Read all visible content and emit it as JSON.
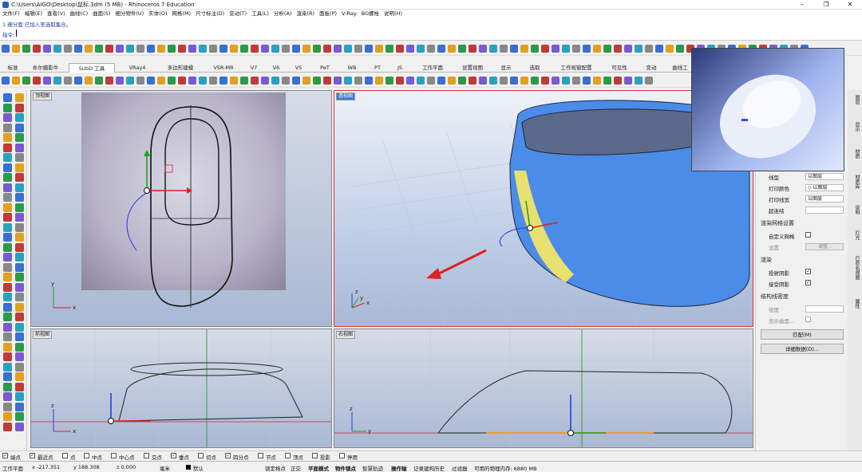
{
  "titlebar": {
    "title": "C:\\Users\\AIGO\\Desktop\\鼠标.3dm (5 MB) - Rhinoceros 7 Education"
  },
  "menu": [
    "文件(F)",
    "编辑(E)",
    "查看(V)",
    "曲线(C)",
    "曲面(S)",
    "细分物件(U)",
    "实体(O)",
    "网格(M)",
    "尺寸标注(D)",
    "变动(T)",
    "工具(L)",
    "分析(A)",
    "渲染(R)",
    "面板(P)",
    "V-Ray",
    "BG螺栓",
    "说明(H)"
  ],
  "command": {
    "history": "1 细分面 已加入至选取集合。",
    "prompt": "指令:"
  },
  "tabs": [
    "标准",
    "牟尔摄影牛",
    "SubD 工具",
    "VRay4",
    "多边形建模",
    "VSR-MR",
    "V7",
    "V6",
    "V5",
    "PeT",
    "WB",
    "PT",
    "JS",
    "工作平面",
    "设置视图",
    "显示",
    "选取",
    "工作视窗配置",
    "可见性",
    "变动",
    "曲线工"
  ],
  "viewports": {
    "top": "顶视图",
    "perspective": "透视图",
    "front": "前视图",
    "right": "右视图"
  },
  "axis": {
    "x": "x",
    "y": "y",
    "z": "z"
  },
  "rightpanel": {
    "linetype_label": "线型",
    "linetype_val": "以图层",
    "printcolor_label": "打印颜色",
    "printcolor_val": "◇ 以图层",
    "printwidth_label": "打印线宽",
    "printwidth_val": "以图层",
    "hyperlink_label": "超连结",
    "hyperlink_val": "",
    "mesh_section": "渲染网格设置",
    "custom_mesh_label": "自定义网格",
    "settings_label": "设置",
    "adjust_btn": "调整...",
    "render_section": "渲染",
    "cast_shadow_label": "投射阴影",
    "recv_shadow_label": "接受阴影",
    "iso_section": "结构线密度",
    "density_label": "密度",
    "show_surface_label": "显示曲面...",
    "match_btn": "匹配(M)",
    "details_btn": "详细数据(D)..."
  },
  "sidetabs": [
    "图层",
    "显示",
    "材质",
    "材质库",
    "说明",
    "灯光",
    "已命名视图",
    "属性"
  ],
  "osnap": [
    "端点",
    "最近点",
    "点",
    "中点",
    "中心点",
    "交点",
    "垂点",
    "切点",
    "四分点",
    "节点",
    "顶点",
    "投影",
    "停用"
  ],
  "osnap_checked": [
    true,
    true,
    false,
    false,
    false,
    false,
    true,
    false,
    true,
    false,
    false,
    false,
    false
  ],
  "status": {
    "cplane": "工作平面",
    "x": "x -217.351",
    "y": "y 188.308",
    "z": "z 0.000",
    "unit": "毫米",
    "layer": "默认",
    "grid_snap": "锁定格点",
    "ortho": "正交",
    "planar": "平面模式",
    "osnap": "物件锁点",
    "smarttrack": "智慧轨迹",
    "gumball": "操作轴",
    "history": "记录建构历史",
    "filter": "过滤器",
    "memory": "可用的物理内存: 6880 MB"
  },
  "colors": {
    "accent": "#3d78d8",
    "viewport_bg": "#a9b8d4",
    "model_blue": "#4a8ce8",
    "gumball_red": "#e02020",
    "gumball_green": "#20a020",
    "gumball_blue": "#2040e0"
  }
}
